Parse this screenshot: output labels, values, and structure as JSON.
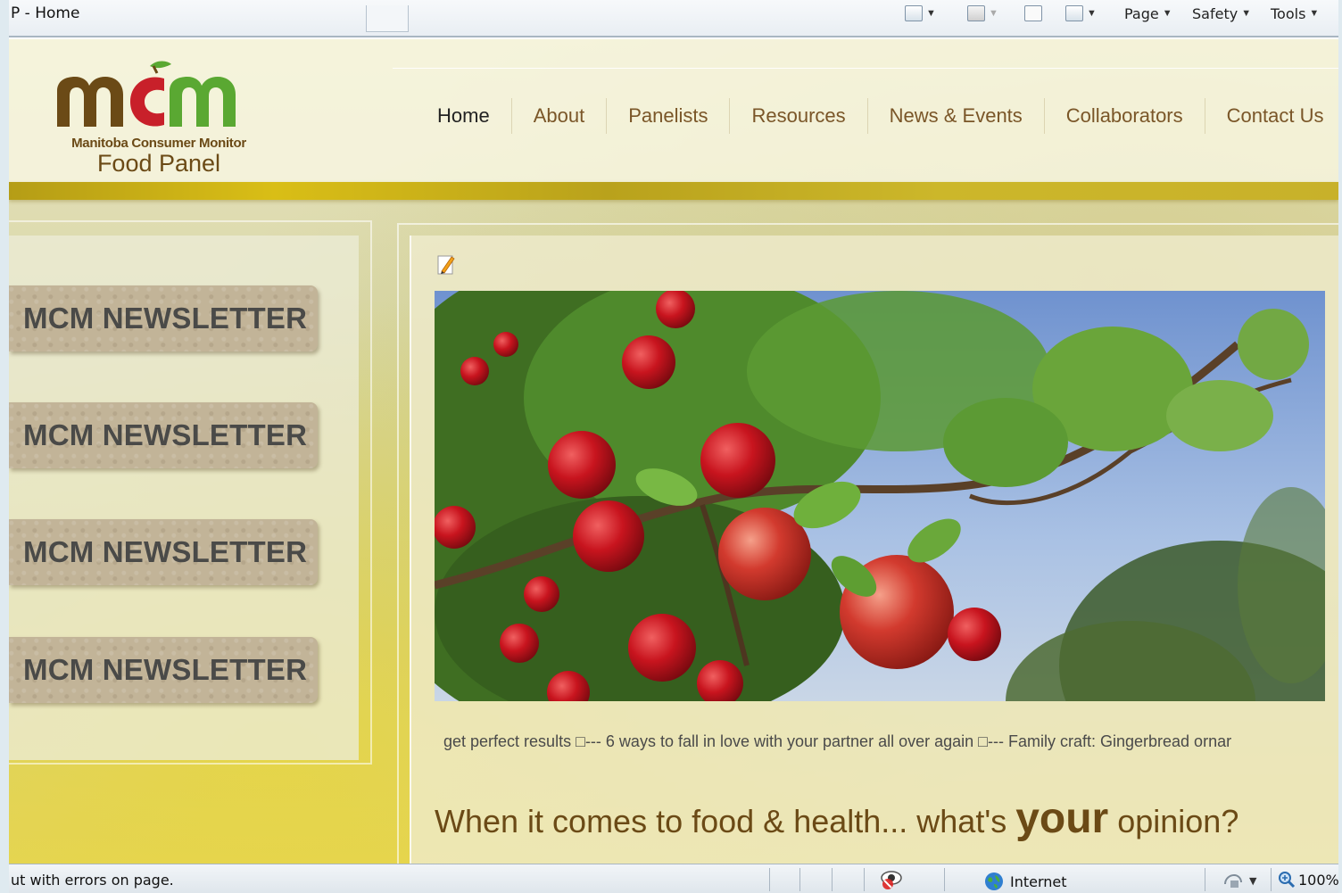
{
  "browser": {
    "tab_title": "P - Home",
    "command_bar": {
      "page_label": "Page",
      "safety_label": "Safety",
      "tools_label": "Tools",
      "icons": [
        "home-icon",
        "feeds-icon",
        "read-mail-icon",
        "print-icon"
      ]
    },
    "status": {
      "message": "ut with errors on page.",
      "zone_label": "Internet",
      "zoom": "100%"
    }
  },
  "site": {
    "logo": {
      "letters": "mcm",
      "subtitle": "Manitoba Consumer Monitor",
      "name": "Food Panel"
    },
    "nav": [
      {
        "label": "Home"
      },
      {
        "label": "About"
      },
      {
        "label": "Panelists"
      },
      {
        "label": "Resources"
      },
      {
        "label": "News & Events"
      },
      {
        "label": "Collaborators"
      },
      {
        "label": "Contact Us"
      }
    ],
    "sidebar": {
      "buttons": [
        {
          "label": "MCM NEWSLETTER"
        },
        {
          "label": "MCM NEWSLETTER"
        },
        {
          "label": "MCM NEWSLETTER"
        },
        {
          "label": "MCM NEWSLETTER"
        }
      ]
    },
    "main": {
      "ticker": "get perfect results □--- 6 ways to fall in love with your partner all over again □--- Family craft: Gingerbread ornar",
      "tagline_pre": "When it comes to food & health... what's ",
      "tagline_emphasis": "your",
      "tagline_post": " opinion?"
    }
  },
  "colors": {
    "brand_brown": "#6b4a16",
    "brand_green": "#5aa832",
    "brand_red": "#c8202a",
    "band_gold": "#c9b21a",
    "button_tan": "#c2b498"
  }
}
